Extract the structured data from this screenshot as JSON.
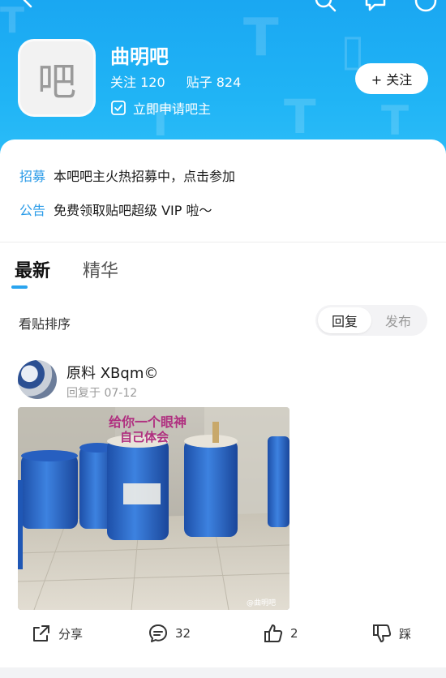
{
  "header": {
    "forum_name": "曲明吧",
    "avatar_char": "吧",
    "follow_count_label": "关注 120",
    "post_count_label": "贴子 824",
    "apply_label": "立即申请吧主",
    "follow_button": "+ 关注"
  },
  "notices": [
    {
      "tag": "招募",
      "text": "本吧吧主火热招募中，点击参加"
    },
    {
      "tag": "公告",
      "text": "免费领取贴吧超级 VIP 啦～"
    }
  ],
  "tabs": [
    {
      "label": "最新",
      "active": true
    },
    {
      "label": "精华",
      "active": false
    }
  ],
  "sort": {
    "label": "看贴排序",
    "options": [
      "回复",
      "发布"
    ],
    "selected": "回复"
  },
  "post": {
    "author": "原料 XBqm©",
    "time": "回复于 07-12",
    "image_caption": "给你一个眼神\n自己体会",
    "watermark": "@曲明吧",
    "actions": {
      "share": "分享",
      "comments": "32",
      "likes": "2",
      "dislike": "踩"
    }
  },
  "colors": {
    "header_blue": "#1aa7f2",
    "accent_blue": "#2a9be8",
    "barrel_blue": "#2f6fd1"
  }
}
